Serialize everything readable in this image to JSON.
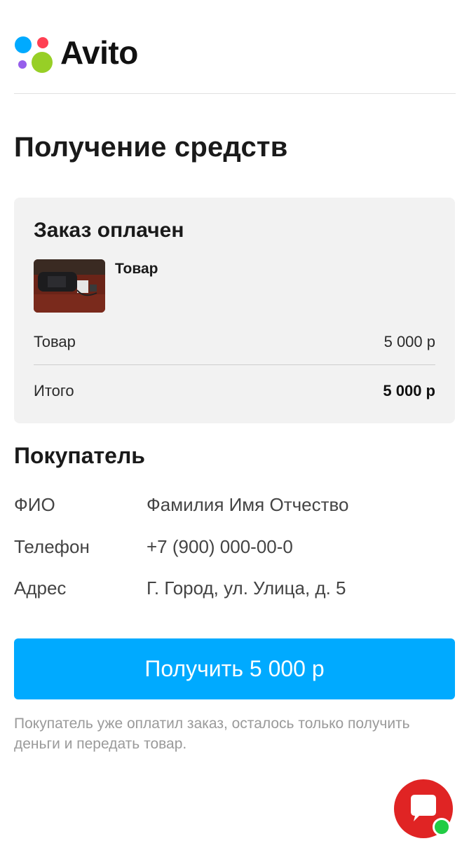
{
  "brand": {
    "name": "Avito"
  },
  "page": {
    "title": "Получение средств"
  },
  "order": {
    "status": "Заказ оплачен",
    "item_name": "Товар",
    "lines": [
      {
        "label": "Товар",
        "value": "5 000 р"
      },
      {
        "label": "Итого",
        "value": "5 000 р"
      }
    ]
  },
  "buyer": {
    "title": "Покупатель",
    "fields": [
      {
        "label": "ФИО",
        "value": "Фамилия Имя Отчество"
      },
      {
        "label": "Телефон",
        "value": "+7 (900) 000-00-0"
      },
      {
        "label": "Адрес",
        "value": "Г. Город, ул. Улица, д. 5"
      }
    ]
  },
  "cta": {
    "label": "Получить 5 000 р"
  },
  "note": "Покупатель уже оплатил заказ, осталось только получить деньги и передать товар.",
  "icons": {
    "logo": "avito-logo-dots-icon",
    "thumbnail": "product-thumbnail",
    "chat": "chat-bubble-icon",
    "online": "online-status-icon"
  },
  "colors": {
    "accent": "#00aaff",
    "card_bg": "#f2f2f2",
    "chat_bg": "#e02424",
    "online": "#22cc44",
    "logo_blue": "#00aaff",
    "logo_red": "#ff4053",
    "logo_purple": "#965eeb",
    "logo_green": "#97cf26"
  }
}
